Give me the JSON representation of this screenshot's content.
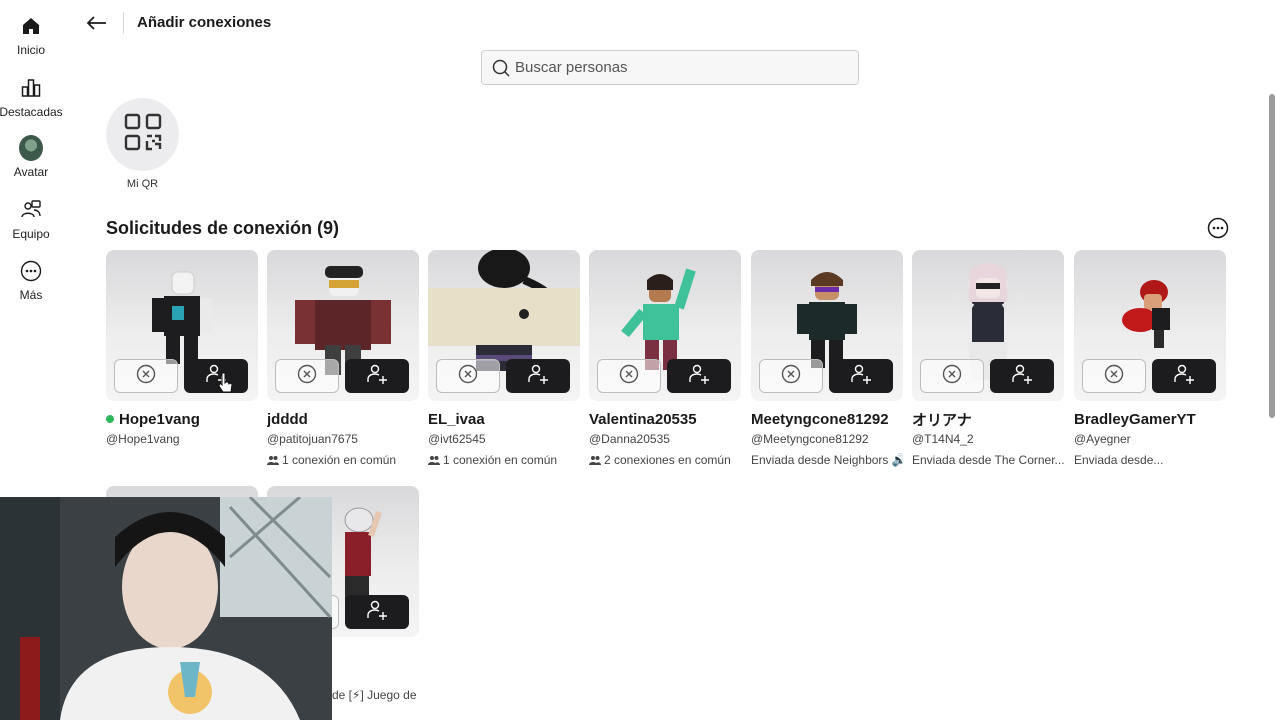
{
  "nav": {
    "items": [
      {
        "label": "Inicio",
        "icon": "home-icon"
      },
      {
        "label": "Destacadas",
        "icon": "charts-icon"
      },
      {
        "label": "Avatar",
        "icon": "avatar-icon"
      },
      {
        "label": "Equipo",
        "icon": "team-icon"
      },
      {
        "label": "Más",
        "icon": "more-icon"
      }
    ]
  },
  "header": {
    "title": "Añadir conexiones"
  },
  "search": {
    "placeholder": "Buscar personas"
  },
  "qr": {
    "label": "Mi QR"
  },
  "section": {
    "title": "Solicitudes de conexión (9)"
  },
  "requests": [
    {
      "name": "Hope1vang",
      "handle": "@Hope1vang",
      "meta": "",
      "online": true
    },
    {
      "name": "jdddd",
      "handle": "@patitojuan7675",
      "meta": "1 conexión en común"
    },
    {
      "name": "EL_ivaa",
      "handle": "@ivt62545",
      "meta": "1 conexión en común"
    },
    {
      "name": "Valentina20535",
      "handle": "@Danna20535",
      "meta": "2 conexiones en común"
    },
    {
      "name": "Meetyngcone81292",
      "handle": "@Meetyngcone81292",
      "meta": "Enviada desde Neighbors 🔊"
    },
    {
      "name": "オリアナ",
      "handle": "@T14N4_2",
      "meta": "Enviada desde The Corner..."
    },
    {
      "name": "BradleyGamerYT",
      "handle": "@Ayegner",
      "meta": "Enviada desde..."
    }
  ],
  "row2": {
    "meta_partial": "de [⚡] Juego de"
  },
  "colors": {
    "accept": "#1c1c1e",
    "online": "#2fb85a",
    "card_bg": "#ededee"
  }
}
